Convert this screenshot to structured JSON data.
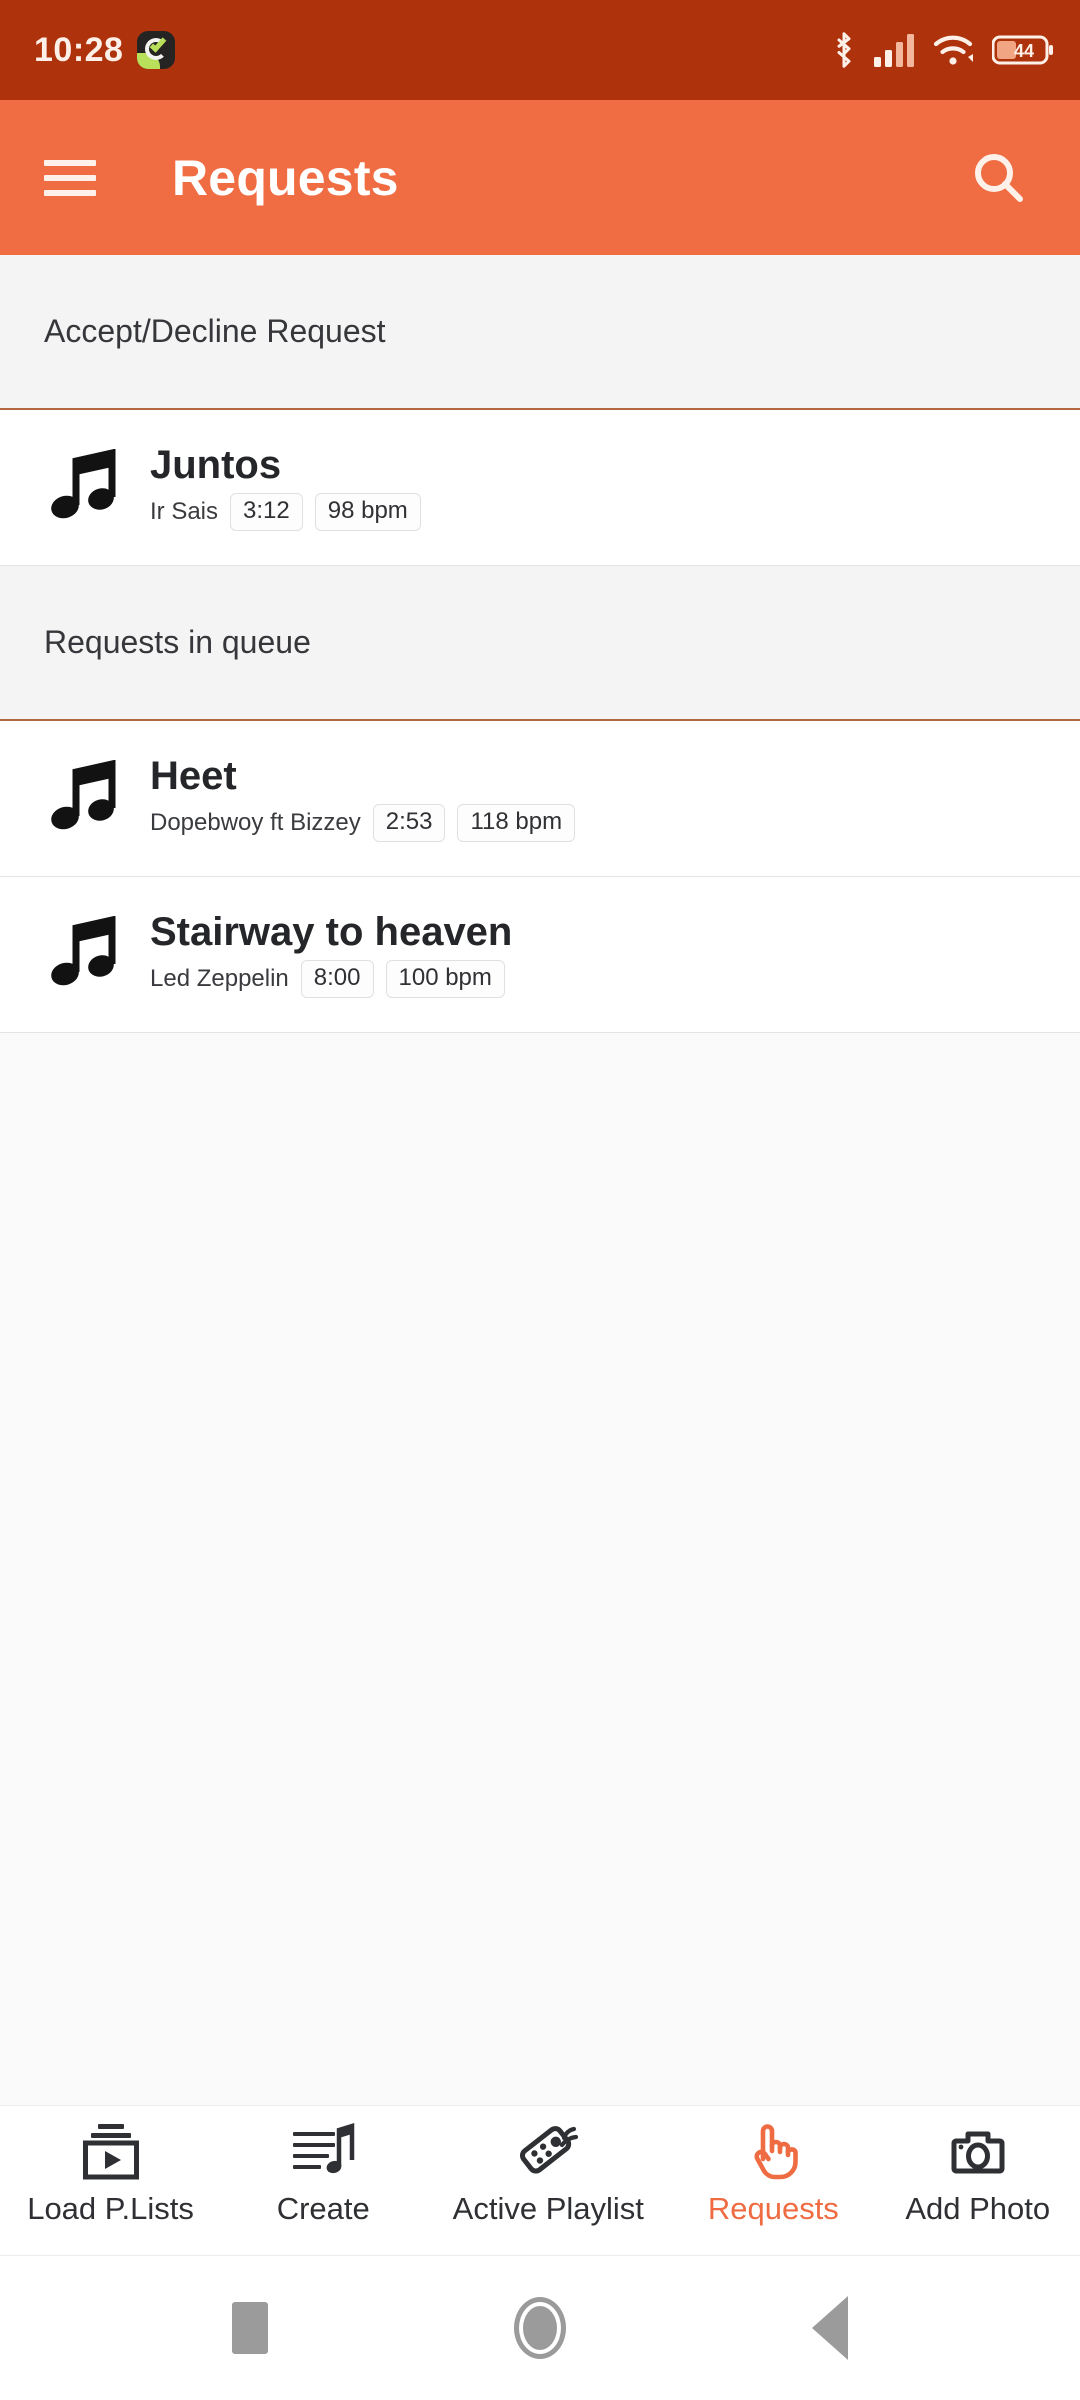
{
  "statusbar": {
    "time": "10:28",
    "app_icon": "checkmark-app-icon",
    "bluetooth_icon": "bluetooth-icon",
    "signal_icon": "cellular-signal-icon",
    "wifi_icon": "wifi-icon",
    "battery_icon": "battery-icon",
    "battery_level": "44"
  },
  "appbar": {
    "menu_icon": "hamburger-menu-icon",
    "title": "Requests",
    "search_icon": "search-icon",
    "bg_color": "#F06C43"
  },
  "sections": [
    {
      "header": "Accept/Decline Request",
      "songs": [
        {
          "title": "Juntos",
          "artist": "Ir Sais",
          "duration": "3:12",
          "bpm": "98 bpm",
          "icon": "music-note-icon"
        }
      ]
    },
    {
      "header": "Requests in queue",
      "songs": [
        {
          "title": "Heet",
          "artist": "Dopebwoy ft Bizzey",
          "duration": "2:53",
          "bpm": "118 bpm",
          "icon": "music-note-icon"
        },
        {
          "title": "Stairway to heaven",
          "artist": "Led Zeppelin",
          "duration": "8:00",
          "bpm": "100 bpm",
          "icon": "music-note-icon"
        }
      ]
    }
  ],
  "bottomnav": {
    "active_color": "#EF6C43",
    "items": [
      {
        "label": "Load P.Lists",
        "icon": "playlist-play-icon",
        "active": false
      },
      {
        "label": "Create",
        "icon": "music-sheet-icon",
        "active": false
      },
      {
        "label": "Active Playlist",
        "icon": "remote-control-icon",
        "active": false
      },
      {
        "label": "Requests",
        "icon": "pointing-hand-icon",
        "active": true
      },
      {
        "label": "Add Photo",
        "icon": "camera-icon",
        "active": false
      }
    ]
  },
  "androidnav": {
    "recents_icon": "recents-square-icon",
    "home_icon": "home-circle-icon",
    "back_icon": "back-triangle-icon"
  }
}
